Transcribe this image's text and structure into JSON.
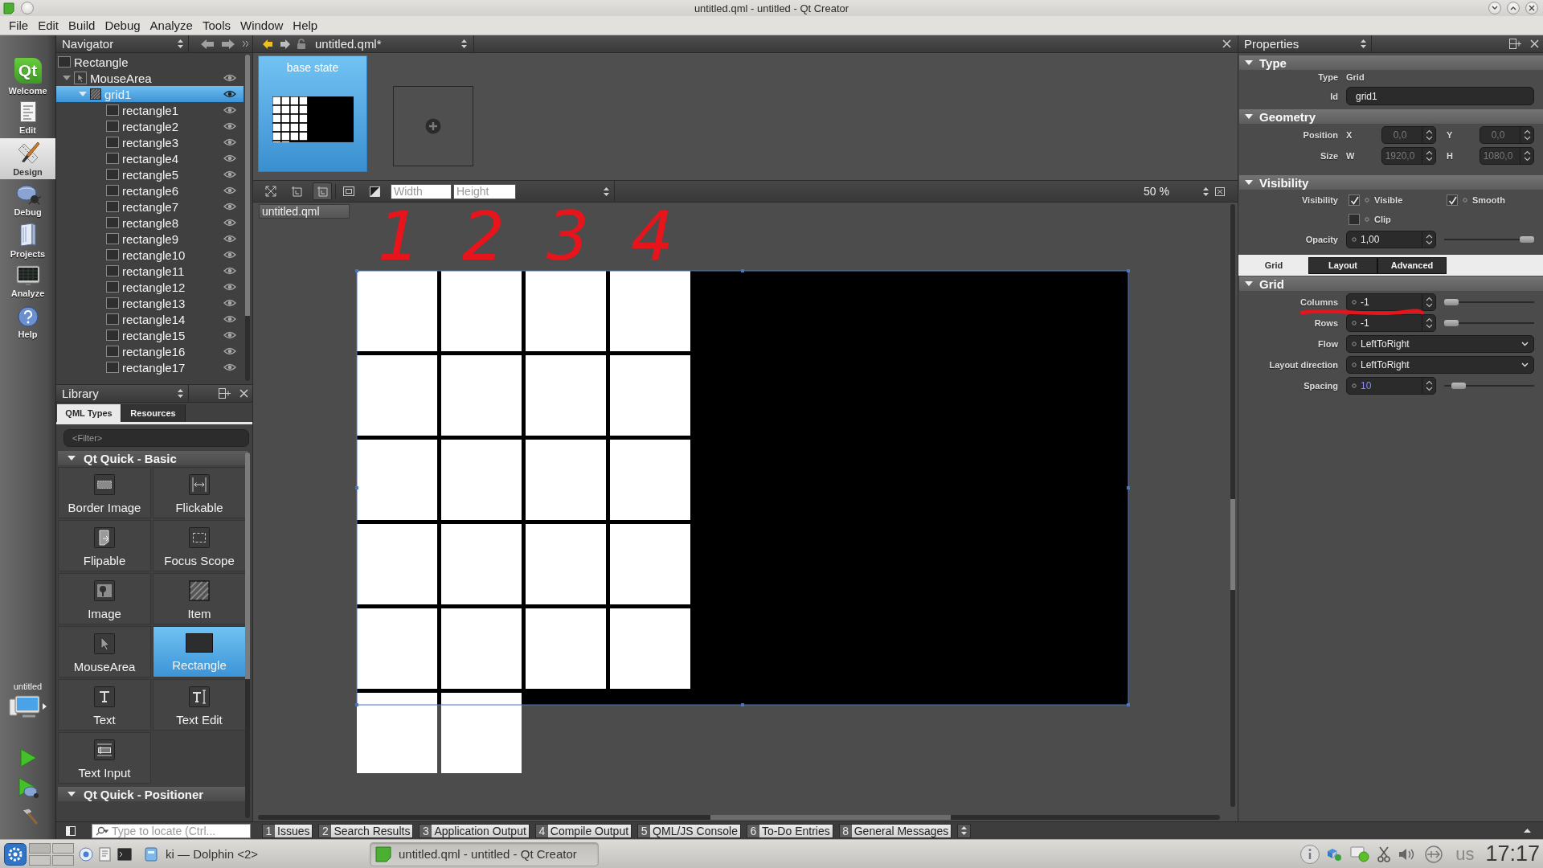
{
  "window": {
    "title": "untitled.qml - untitled - Qt Creator"
  },
  "menu": [
    "File",
    "Edit",
    "Build",
    "Debug",
    "Analyze",
    "Tools",
    "Window",
    "Help"
  ],
  "mode_bar": {
    "modes": [
      {
        "kind": "welcome",
        "logo": "Qt",
        "label": "Welcome",
        "selected": false
      },
      {
        "kind": "edit",
        "label": "Edit",
        "selected": false
      },
      {
        "kind": "design",
        "label": "Design",
        "selected": true
      },
      {
        "kind": "debug",
        "label": "Debug",
        "selected": false
      },
      {
        "kind": "projects",
        "label": "Projects",
        "selected": false
      },
      {
        "kind": "analyze",
        "label": "Analyze",
        "selected": false
      },
      {
        "kind": "help",
        "label": "Help",
        "selected": false
      }
    ],
    "kit": "untitled"
  },
  "navigator": {
    "title": "Navigator",
    "tree": [
      {
        "label": "Rectangle",
        "kind": "rectangle",
        "selected": false,
        "children": [
          {
            "label": "MouseArea",
            "kind": "mousearea",
            "selected": false,
            "expanded": true,
            "visible": true,
            "children": [
              {
                "label": "grid1",
                "kind": "grid",
                "selected": true,
                "expanded": true,
                "visible": true,
                "children": [
                  {
                    "label": "rectangle1",
                    "kind": "rectangle",
                    "selected": false,
                    "visible": true
                  },
                  {
                    "label": "rectangle2",
                    "kind": "rectangle",
                    "selected": false,
                    "visible": true
                  },
                  {
                    "label": "rectangle3",
                    "kind": "rectangle",
                    "selected": false,
                    "visible": true
                  },
                  {
                    "label": "rectangle4",
                    "kind": "rectangle",
                    "selected": false,
                    "visible": true
                  },
                  {
                    "label": "rectangle5",
                    "kind": "rectangle",
                    "selected": false,
                    "visible": true
                  },
                  {
                    "label": "rectangle6",
                    "kind": "rectangle",
                    "selected": false,
                    "visible": true
                  },
                  {
                    "label": "rectangle7",
                    "kind": "rectangle",
                    "selected": false,
                    "visible": true
                  },
                  {
                    "label": "rectangle8",
                    "kind": "rectangle",
                    "selected": false,
                    "visible": true
                  },
                  {
                    "label": "rectangle9",
                    "kind": "rectangle",
                    "selected": false,
                    "visible": true
                  },
                  {
                    "label": "rectangle10",
                    "kind": "rectangle",
                    "selected": false,
                    "visible": true
                  },
                  {
                    "label": "rectangle11",
                    "kind": "rectangle",
                    "selected": false,
                    "visible": true
                  },
                  {
                    "label": "rectangle12",
                    "kind": "rectangle",
                    "selected": false,
                    "visible": true
                  },
                  {
                    "label": "rectangle13",
                    "kind": "rectangle",
                    "selected": false,
                    "visible": true
                  },
                  {
                    "label": "rectangle14",
                    "kind": "rectangle",
                    "selected": false,
                    "visible": true
                  },
                  {
                    "label": "rectangle15",
                    "kind": "rectangle",
                    "selected": false,
                    "visible": true
                  },
                  {
                    "label": "rectangle16",
                    "kind": "rectangle",
                    "selected": false,
                    "visible": true
                  },
                  {
                    "label": "rectangle17",
                    "kind": "rectangle",
                    "selected": false,
                    "visible": true
                  }
                ]
              }
            ]
          }
        ]
      }
    ]
  },
  "library": {
    "title": "Library",
    "tabs": [
      {
        "label": "QML Types",
        "selected": true
      },
      {
        "label": "Resources",
        "selected": false
      }
    ],
    "filter": {
      "placeholder": "<Filter>"
    },
    "sections": [
      {
        "title": "Qt Quick - Basic",
        "expanded": true,
        "items": [
          {
            "label": "Border Image",
            "kind": "border-image",
            "selected": false
          },
          {
            "label": "Flickable",
            "kind": "flickable",
            "selected": false
          },
          {
            "label": "Flipable",
            "kind": "flipable",
            "selected": false
          },
          {
            "label": "Focus Scope",
            "kind": "focus-scope",
            "selected": false
          },
          {
            "label": "Image",
            "kind": "image",
            "selected": false
          },
          {
            "label": "Item",
            "kind": "item",
            "selected": false
          },
          {
            "label": "MouseArea",
            "kind": "mouse-area",
            "selected": false
          },
          {
            "label": "Rectangle",
            "kind": "rectangle",
            "selected": true
          },
          {
            "label": "Text",
            "kind": "text",
            "selected": false
          },
          {
            "label": "Text Edit",
            "kind": "text-edit",
            "selected": false
          },
          {
            "label": "Text Input",
            "kind": "text-input",
            "selected": false
          }
        ]
      },
      {
        "title": "Qt Quick - Positioner",
        "expanded": true
      }
    ]
  },
  "editor": {
    "file": "untitled.qml*",
    "states": [
      {
        "label": "base state",
        "selected": true
      }
    ],
    "toolbar": {
      "tools": [
        {
          "kind": "crossed-frame",
          "selected": false
        },
        {
          "kind": "bracket-frame",
          "selected": false
        },
        {
          "kind": "bracket-frame",
          "selected": true
        },
        {
          "kind": "nested-square",
          "selected": false
        },
        {
          "kind": "split-square",
          "selected": false
        }
      ],
      "width": {
        "placeholder": "Width"
      },
      "height": {
        "placeholder": "Height"
      },
      "zoom": "50 %"
    },
    "document_tab": "untitled.qml",
    "annotations": [
      "1",
      "2",
      "3",
      "4"
    ]
  },
  "properties": {
    "title": "Properties",
    "type": {
      "title": "Type",
      "expanded": true,
      "type_label": "Type",
      "type_value": "Grid",
      "id_label": "Id",
      "id_value": "grid1"
    },
    "geometry": {
      "title": "Geometry",
      "expanded": true,
      "rows": [
        {
          "label": "Position",
          "fields": [
            {
              "axis": "X",
              "value": "0,0",
              "disabled": true
            },
            {
              "axis": "Y",
              "value": "0,0",
              "disabled": true
            }
          ]
        },
        {
          "label": "Size",
          "fields": [
            {
              "axis": "W",
              "value": "1920,0",
              "disabled": true
            },
            {
              "axis": "H",
              "value": "1080,0",
              "disabled": true
            }
          ]
        }
      ]
    },
    "visibility": {
      "title": "Visibility",
      "expanded": true,
      "label": "Visibility",
      "checks": [
        {
          "label": "Visible",
          "checked": true
        },
        {
          "label": "Smooth",
          "checked": true
        },
        {
          "label": "Clip",
          "checked": false
        }
      ],
      "opacity": {
        "label": "Opacity",
        "value": "1,00",
        "level": 1
      }
    },
    "tabs": [
      {
        "label": "Grid",
        "selected": true
      },
      {
        "label": "Layout",
        "selected": false
      },
      {
        "label": "Advanced",
        "selected": false
      }
    ],
    "grid": {
      "title": "Grid",
      "expanded": true,
      "rows": [
        {
          "kind": "spin",
          "label": "Columns",
          "value": "-1",
          "modified": false,
          "level": 0
        },
        {
          "kind": "spin",
          "label": "Rows",
          "value": "-1",
          "modified": false,
          "level": 0
        },
        {
          "kind": "combo",
          "label": "Flow",
          "value": "LeftToRight",
          "modified": false
        },
        {
          "kind": "combo",
          "label": "Layout direction",
          "value": "LeftToRight",
          "modified": false
        },
        {
          "kind": "spin",
          "label": "Spacing",
          "value": "10",
          "modified": true,
          "level": 0.1
        }
      ]
    }
  },
  "output_bar": {
    "locator": {
      "placeholder": "Type to locate (Ctrl..."
    },
    "panes": [
      {
        "number": "1",
        "label": "Issues"
      },
      {
        "number": "2",
        "label": "Search Results"
      },
      {
        "number": "3",
        "label": "Application Output"
      },
      {
        "number": "4",
        "label": "Compile Output"
      },
      {
        "number": "5",
        "label": "QML/JS Console"
      },
      {
        "number": "6",
        "label": "To-Do Entries"
      },
      {
        "number": "8",
        "label": "General Messages"
      }
    ]
  },
  "taskbar": {
    "tasks": [
      {
        "label": "ki — Dolphin <2>",
        "kind": "file-manager",
        "selected": false
      },
      {
        "label": "untitled.qml - untitled - Qt Creator",
        "kind": "ide",
        "selected": true
      }
    ],
    "keyboard_layout": "us",
    "clock": "17:17"
  }
}
